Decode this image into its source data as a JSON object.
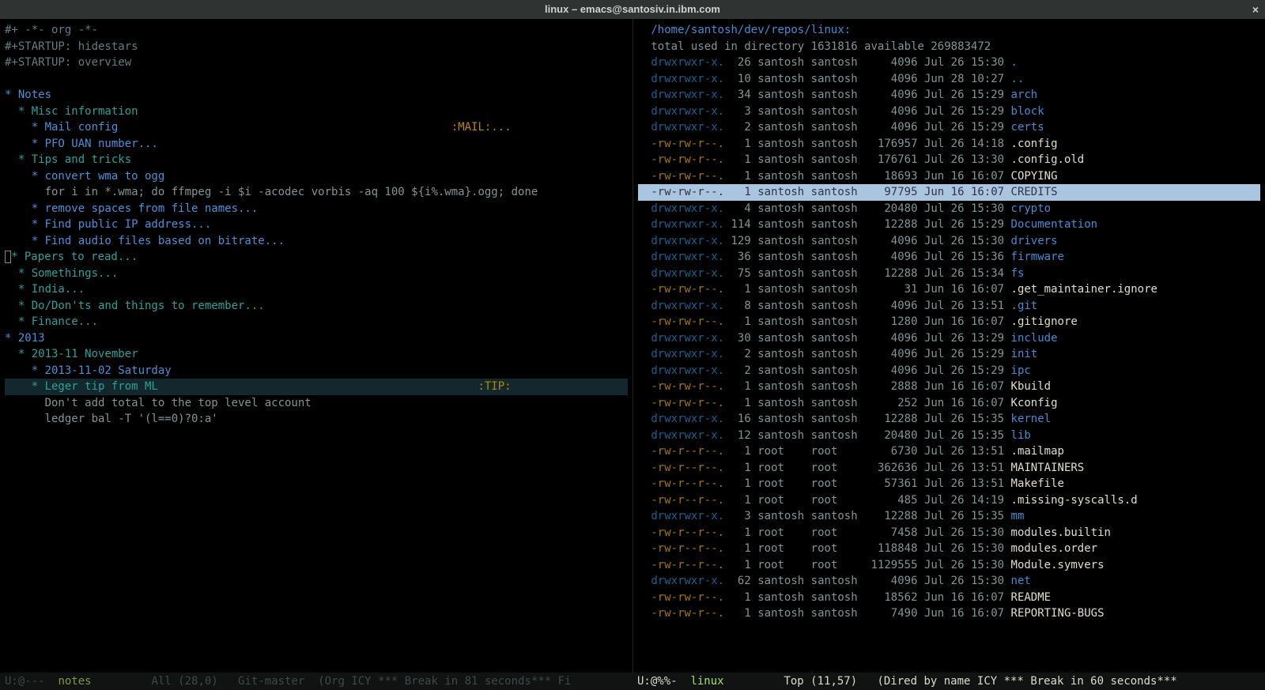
{
  "titlebar": {
    "title": "linux – emacs@santosiv.in.ibm.com",
    "close": "×"
  },
  "left": {
    "lines": [
      {
        "cls": "dim",
        "text": "#+ -*- org -*-"
      },
      {
        "cls": "dim",
        "text": "#+STARTUP: hidestars"
      },
      {
        "cls": "dim",
        "text": "#+STARTUP: overview"
      },
      {
        "cls": "",
        "text": ""
      },
      {
        "cls": "hl1",
        "text": "* Notes"
      },
      {
        "cls": "hl-teal",
        "text": "  * Misc information"
      },
      {
        "cls": "hl1",
        "text": "    * Mail config",
        "tag": ":MAIL:..."
      },
      {
        "cls": "hl1",
        "text": "    * PFO UAN number..."
      },
      {
        "cls": "hl-teal",
        "text": "  * Tips and tricks"
      },
      {
        "cls": "hl1",
        "text": "    * convert wma to ogg"
      },
      {
        "cls": "",
        "text": "      for i in *.wma; do ffmpeg -i $i -acodec vorbis -aq 100 ${i%.wma}.ogg; done"
      },
      {
        "cls": "hl1",
        "text": "    * remove spaces from file names..."
      },
      {
        "cls": "hl1",
        "text": "    * Find public IP address..."
      },
      {
        "cls": "hl1",
        "text": "    * Find audio files based on bitrate..."
      },
      {
        "cls": "hl-teal",
        "text": "  * Papers to read...",
        "box": true
      },
      {
        "cls": "hl-teal",
        "text": "  * Somethings..."
      },
      {
        "cls": "hl-teal",
        "text": "  * India..."
      },
      {
        "cls": "hl-teal",
        "text": "  * Do/Don'ts and things to remember..."
      },
      {
        "cls": "hl-teal",
        "text": "  * Finance..."
      },
      {
        "cls": "hl1",
        "text": "* 2013"
      },
      {
        "cls": "hl-teal",
        "text": "  * 2013-11 November"
      },
      {
        "cls": "hl1",
        "text": "    * 2013-11-02 Saturday"
      },
      {
        "cls": "hl-teal",
        "text": "    * Leger tip from ML",
        "tag": ":TIP:",
        "hl": true
      },
      {
        "cls": "",
        "text": "      Don't add total to the top level account"
      },
      {
        "cls": "",
        "text": "      ledger bal -T '(l==0)?0:a'"
      }
    ]
  },
  "right": {
    "path": "/home/santosh/dev/repos/linux:",
    "summary": "  total used in directory 1631816 available 269883472",
    "entries": [
      {
        "perms": "drwxrwxr-x.",
        "n": "26",
        "u": "santosh",
        "g": "santosh",
        "size": "4096",
        "date": "Jul 26 15:30",
        "name": ".",
        "dir": true
      },
      {
        "perms": "drwxrwxr-x.",
        "n": "10",
        "u": "santosh",
        "g": "santosh",
        "size": "4096",
        "date": "Jun 28 10:27",
        "name": "..",
        "dir": true
      },
      {
        "perms": "drwxrwxr-x.",
        "n": "34",
        "u": "santosh",
        "g": "santosh",
        "size": "4096",
        "date": "Jul 26 15:29",
        "name": "arch",
        "dir": true
      },
      {
        "perms": "drwxrwxr-x.",
        "n": "3",
        "u": "santosh",
        "g": "santosh",
        "size": "4096",
        "date": "Jul 26 15:29",
        "name": "block",
        "dir": true
      },
      {
        "perms": "drwxrwxr-x.",
        "n": "2",
        "u": "santosh",
        "g": "santosh",
        "size": "4096",
        "date": "Jul 26 15:29",
        "name": "certs",
        "dir": true
      },
      {
        "perms": "-rw-rw-r--.",
        "n": "1",
        "u": "santosh",
        "g": "santosh",
        "size": "176957",
        "date": "Jul 26 14:18",
        "name": ".config",
        "dir": false
      },
      {
        "perms": "-rw-rw-r--.",
        "n": "1",
        "u": "santosh",
        "g": "santosh",
        "size": "176761",
        "date": "Jul 26 13:30",
        "name": ".config.old",
        "dir": false
      },
      {
        "perms": "-rw-rw-r--.",
        "n": "1",
        "u": "santosh",
        "g": "santosh",
        "size": "18693",
        "date": "Jun 16 16:07",
        "name": "COPYING",
        "dir": false
      },
      {
        "perms": "-rw-rw-r--.",
        "n": "1",
        "u": "santosh",
        "g": "santosh",
        "size": "97795",
        "date": "Jun 16 16:07",
        "name": "CREDITS",
        "dir": false,
        "selected": true
      },
      {
        "perms": "drwxrwxr-x.",
        "n": "4",
        "u": "santosh",
        "g": "santosh",
        "size": "20480",
        "date": "Jul 26 15:30",
        "name": "crypto",
        "dir": true
      },
      {
        "perms": "drwxrwxr-x.",
        "n": "114",
        "u": "santosh",
        "g": "santosh",
        "size": "12288",
        "date": "Jul 26 15:29",
        "name": "Documentation",
        "dir": true
      },
      {
        "perms": "drwxrwxr-x.",
        "n": "129",
        "u": "santosh",
        "g": "santosh",
        "size": "4096",
        "date": "Jul 26 15:30",
        "name": "drivers",
        "dir": true
      },
      {
        "perms": "drwxrwxr-x.",
        "n": "36",
        "u": "santosh",
        "g": "santosh",
        "size": "4096",
        "date": "Jul 26 15:36",
        "name": "firmware",
        "dir": true
      },
      {
        "perms": "drwxrwxr-x.",
        "n": "75",
        "u": "santosh",
        "g": "santosh",
        "size": "12288",
        "date": "Jul 26 15:34",
        "name": "fs",
        "dir": true
      },
      {
        "perms": "-rw-rw-r--.",
        "n": "1",
        "u": "santosh",
        "g": "santosh",
        "size": "31",
        "date": "Jun 16 16:07",
        "name": ".get_maintainer.ignore",
        "dir": false
      },
      {
        "perms": "drwxrwxr-x.",
        "n": "8",
        "u": "santosh",
        "g": "santosh",
        "size": "4096",
        "date": "Jul 26 13:51",
        "name": ".git",
        "dir": true
      },
      {
        "perms": "-rw-rw-r--.",
        "n": "1",
        "u": "santosh",
        "g": "santosh",
        "size": "1280",
        "date": "Jun 16 16:07",
        "name": ".gitignore",
        "dir": false
      },
      {
        "perms": "drwxrwxr-x.",
        "n": "30",
        "u": "santosh",
        "g": "santosh",
        "size": "4096",
        "date": "Jul 26 13:29",
        "name": "include",
        "dir": true
      },
      {
        "perms": "drwxrwxr-x.",
        "n": "2",
        "u": "santosh",
        "g": "santosh",
        "size": "4096",
        "date": "Jul 26 15:29",
        "name": "init",
        "dir": true
      },
      {
        "perms": "drwxrwxr-x.",
        "n": "2",
        "u": "santosh",
        "g": "santosh",
        "size": "4096",
        "date": "Jul 26 15:29",
        "name": "ipc",
        "dir": true
      },
      {
        "perms": "-rw-rw-r--.",
        "n": "1",
        "u": "santosh",
        "g": "santosh",
        "size": "2888",
        "date": "Jun 16 16:07",
        "name": "Kbuild",
        "dir": false
      },
      {
        "perms": "-rw-rw-r--.",
        "n": "1",
        "u": "santosh",
        "g": "santosh",
        "size": "252",
        "date": "Jun 16 16:07",
        "name": "Kconfig",
        "dir": false
      },
      {
        "perms": "drwxrwxr-x.",
        "n": "16",
        "u": "santosh",
        "g": "santosh",
        "size": "12288",
        "date": "Jul 26 15:35",
        "name": "kernel",
        "dir": true
      },
      {
        "perms": "drwxrwxr-x.",
        "n": "12",
        "u": "santosh",
        "g": "santosh",
        "size": "20480",
        "date": "Jul 26 15:35",
        "name": "lib",
        "dir": true
      },
      {
        "perms": "-rw-r--r--.",
        "n": "1",
        "u": "root",
        "g": "root",
        "size": "6730",
        "date": "Jul 26 13:51",
        "name": ".mailmap",
        "dir": false
      },
      {
        "perms": "-rw-r--r--.",
        "n": "1",
        "u": "root",
        "g": "root",
        "size": "362636",
        "date": "Jul 26 13:51",
        "name": "MAINTAINERS",
        "dir": false
      },
      {
        "perms": "-rw-r--r--.",
        "n": "1",
        "u": "root",
        "g": "root",
        "size": "57361",
        "date": "Jul 26 13:51",
        "name": "Makefile",
        "dir": false
      },
      {
        "perms": "-rw-r--r--.",
        "n": "1",
        "u": "root",
        "g": "root",
        "size": "485",
        "date": "Jul 26 14:19",
        "name": ".missing-syscalls.d",
        "dir": false
      },
      {
        "perms": "drwxrwxr-x.",
        "n": "3",
        "u": "santosh",
        "g": "santosh",
        "size": "12288",
        "date": "Jul 26 15:35",
        "name": "mm",
        "dir": true
      },
      {
        "perms": "-rw-r--r--.",
        "n": "1",
        "u": "root",
        "g": "root",
        "size": "7458",
        "date": "Jul 26 15:30",
        "name": "modules.builtin",
        "dir": false
      },
      {
        "perms": "-rw-r--r--.",
        "n": "1",
        "u": "root",
        "g": "root",
        "size": "118848",
        "date": "Jul 26 15:30",
        "name": "modules.order",
        "dir": false
      },
      {
        "perms": "-rw-r--r--.",
        "n": "1",
        "u": "root",
        "g": "root",
        "size": "1129555",
        "date": "Jul 26 15:30",
        "name": "Module.symvers",
        "dir": false
      },
      {
        "perms": "drwxrwxr-x.",
        "n": "62",
        "u": "santosh",
        "g": "santosh",
        "size": "4096",
        "date": "Jul 26 15:30",
        "name": "net",
        "dir": true
      },
      {
        "perms": "-rw-rw-r--.",
        "n": "1",
        "u": "santosh",
        "g": "santosh",
        "size": "18562",
        "date": "Jun 16 16:07",
        "name": "README",
        "dir": false
      },
      {
        "perms": "-rw-rw-r--.",
        "n": "1",
        "u": "santosh",
        "g": "santosh",
        "size": "7490",
        "date": "Jun 16 16:07",
        "name": "REPORTING-BUGS",
        "dir": false
      }
    ]
  },
  "modeline": {
    "left_pre": "U:@---  ",
    "left_buf": "notes",
    "left_post": "         All (28,0)   Git-master  (Org ICY *** Break in 81 seconds*** Fi",
    "right_pre": "U:@%%-  ",
    "right_buf": "linux",
    "right_post": "         Top (11,57)   (Dired by name ICY *** Break in 60 seconds***"
  }
}
